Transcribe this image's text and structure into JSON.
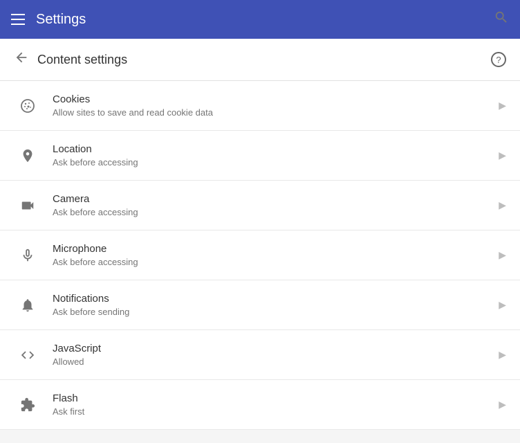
{
  "header": {
    "title": "Settings",
    "hamburger_label": "Menu",
    "search_label": "Search"
  },
  "subheader": {
    "title": "Content settings",
    "back_label": "Back",
    "help_label": "Help"
  },
  "items": [
    {
      "id": "cookies",
      "title": "Cookies",
      "subtitle": "Allow sites to save and read cookie data",
      "icon": "cookie"
    },
    {
      "id": "location",
      "title": "Location",
      "subtitle": "Ask before accessing",
      "icon": "location"
    },
    {
      "id": "camera",
      "title": "Camera",
      "subtitle": "Ask before accessing",
      "icon": "camera"
    },
    {
      "id": "microphone",
      "title": "Microphone",
      "subtitle": "Ask before accessing",
      "icon": "microphone"
    },
    {
      "id": "notifications",
      "title": "Notifications",
      "subtitle": "Ask before sending",
      "icon": "bell"
    },
    {
      "id": "javascript",
      "title": "JavaScript",
      "subtitle": "Allowed",
      "icon": "code"
    },
    {
      "id": "flash",
      "title": "Flash",
      "subtitle": "Ask first",
      "icon": "puzzle"
    }
  ]
}
